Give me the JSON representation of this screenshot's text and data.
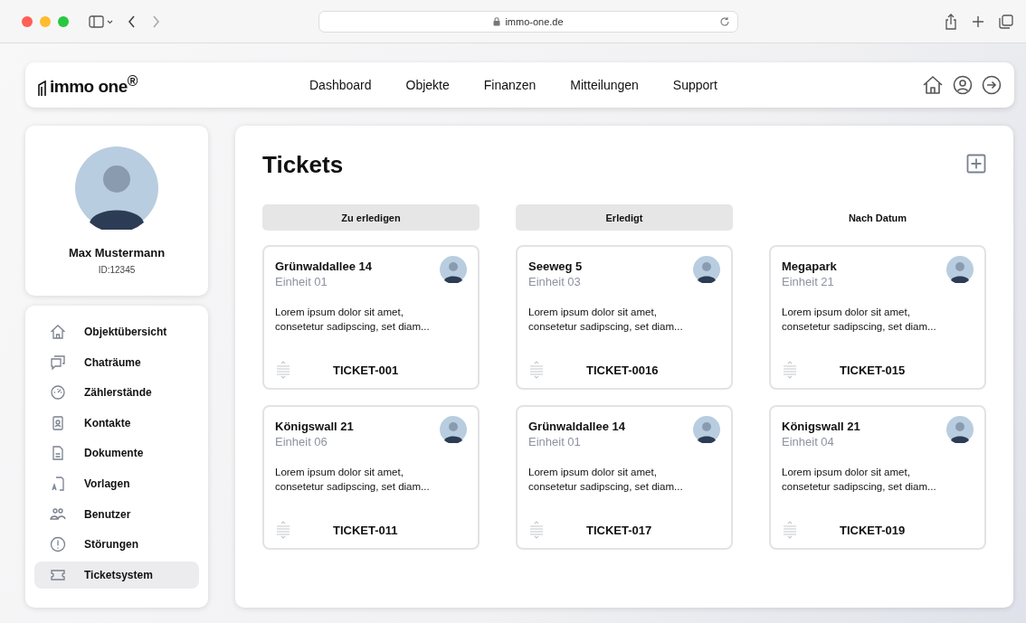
{
  "browser": {
    "url": "immo-one.de"
  },
  "header": {
    "logo": "immo one$^{®}$",
    "nav": [
      {
        "label": "Dashboard"
      },
      {
        "label": "Objekte"
      },
      {
        "label": "Finanzen"
      },
      {
        "label": "Mitteilungen"
      },
      {
        "label": "Support"
      }
    ]
  },
  "profile": {
    "name": "Max Mustermann",
    "id": "ID:12345"
  },
  "sidebar": {
    "items": [
      {
        "label": "Objektübersicht",
        "selected": false
      },
      {
        "label": "Chaträume",
        "selected": false
      },
      {
        "label": "Zählerstände",
        "selected": false
      },
      {
        "label": "Kontakte",
        "selected": false
      },
      {
        "label": "Dokumente",
        "selected": false
      },
      {
        "label": "Vorlagen",
        "selected": false
      },
      {
        "label": "Benutzer",
        "selected": false
      },
      {
        "label": "Störungen",
        "selected": false
      },
      {
        "label": "Ticketsystem",
        "selected": true
      }
    ]
  },
  "page": {
    "title": "Tickets"
  },
  "columns": [
    {
      "label": "Zu erledigen",
      "selected": true,
      "tickets": [
        {
          "address": "Grünwaldallee 14",
          "unit": "Einheit 01",
          "text": "Lorem ipsum dolor sit amet, consetetur sadipscing, set diam...",
          "id": "TICKET-001"
        },
        {
          "address": "Königswall 21",
          "unit": "Einheit 06",
          "text": "Lorem ipsum dolor sit amet, consetetur sadipscing, set diam...",
          "id": "TICKET-011"
        }
      ]
    },
    {
      "label": "Erledigt",
      "selected": true,
      "tickets": [
        {
          "address": "Seeweg 5",
          "unit": "Einheit 03",
          "text": "Lorem ipsum dolor sit amet, consetetur sadipscing, set diam...",
          "id": "TICKET-0016"
        },
        {
          "address": "Grünwaldallee 14",
          "unit": "Einheit 01",
          "text": "Lorem ipsum dolor sit amet, consetetur sadipscing, set diam...",
          "id": "TICKET-017"
        }
      ]
    },
    {
      "label": "Nach Datum",
      "selected": false,
      "tickets": [
        {
          "address": "Megapark",
          "unit": "Einheit 21",
          "text": "Lorem ipsum dolor sit amet, consetetur sadipscing, set diam...",
          "id": "TICKET-015"
        },
        {
          "address": "Königswall 21",
          "unit": "Einheit 04",
          "text": "Lorem ipsum dolor sit amet, consetetur sadipscing, set diam...",
          "id": "TICKET-019"
        }
      ]
    }
  ]
}
